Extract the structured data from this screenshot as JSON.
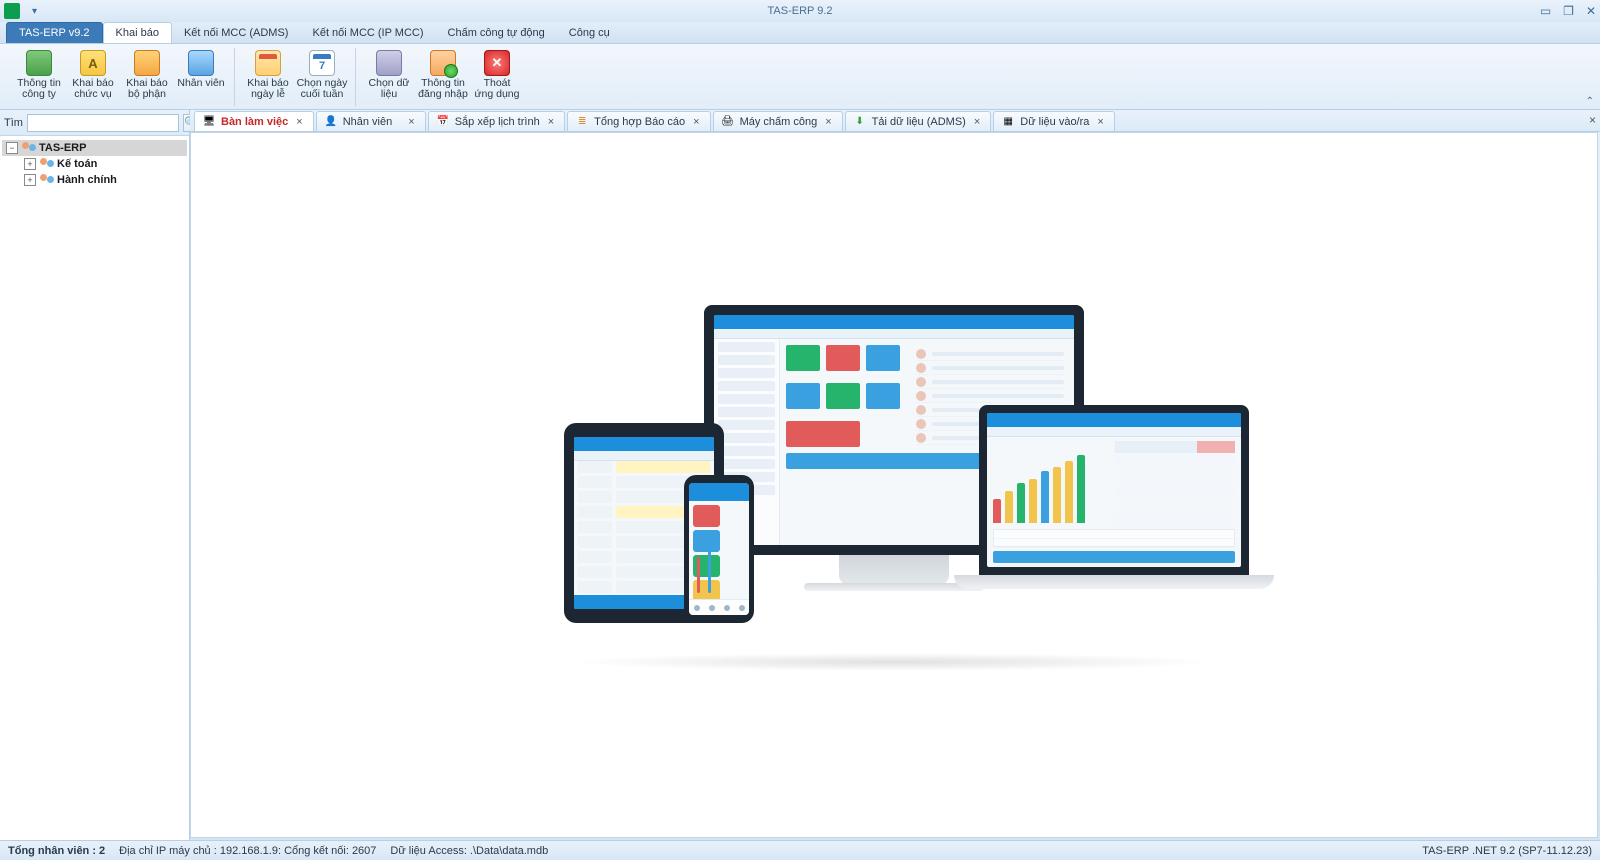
{
  "title": "TAS-ERP 9.2",
  "menus": {
    "first": "TAS-ERP v9.2",
    "items": [
      "Khai báo",
      "Kết nối MCC (ADMS)",
      "Kết nối MCC (IP MCC)",
      "Chấm công tự động",
      "Công cụ"
    ],
    "active_index": 0
  },
  "ribbon": {
    "group1": [
      {
        "id": "company-info",
        "label": "Thông tin\ncông ty"
      },
      {
        "id": "position",
        "label": "Khai báo\nchức vụ"
      },
      {
        "id": "department",
        "label": "Khai báo\nbộ phận"
      },
      {
        "id": "employee",
        "label": "Nhân viên"
      }
    ],
    "group2": [
      {
        "id": "holiday",
        "label": "Khai báo\nngày lễ"
      },
      {
        "id": "weekend",
        "label": "Chọn ngày\ncuối tuần"
      }
    ],
    "group3": [
      {
        "id": "select-data",
        "label": "Chọn dữ\nliệu"
      },
      {
        "id": "login-info",
        "label": "Thông tin\nđăng nhập"
      },
      {
        "id": "exit-app",
        "label": "Thoát\nứng dụng"
      }
    ]
  },
  "search": {
    "label": "Tìm",
    "value": ""
  },
  "tree": {
    "root": "TAS-ERP",
    "children": [
      "Kế toán",
      "Hành chính"
    ]
  },
  "tabs": [
    {
      "id": "workspace",
      "label": "Bàn làm việc",
      "active": true
    },
    {
      "id": "employees",
      "label": "Nhân viên"
    },
    {
      "id": "schedule",
      "label": "Sắp xếp lịch trình"
    },
    {
      "id": "reports",
      "label": "Tổng hợp  Báo cáo"
    },
    {
      "id": "device",
      "label": "Máy chấm công"
    },
    {
      "id": "download-adms",
      "label": "Tải dữ liệu (ADMS)"
    },
    {
      "id": "inout-data",
      "label": "Dữ liệu vào/ra"
    }
  ],
  "status": {
    "total_label": "Tổng nhân viên : 2",
    "ip_label": "Địa chỉ IP máy chủ : 192.168.1.9: Cổng kết nối: 2607",
    "access_label": "Dữ liệu Access: .\\Data\\data.mdb",
    "version": "TAS-ERP .NET 9.2 (SP7-11.12.23)"
  }
}
